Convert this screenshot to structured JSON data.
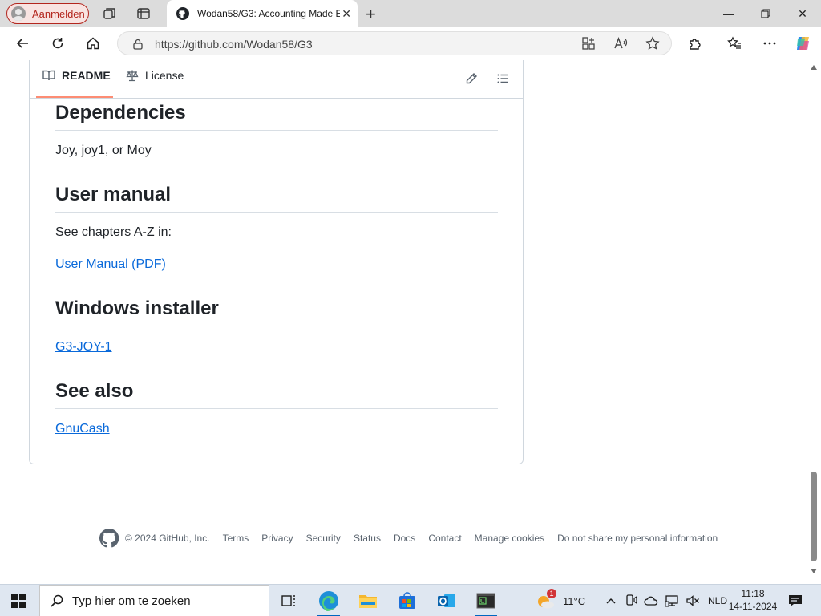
{
  "browser": {
    "profile_label": "Aanmelden",
    "tab_title": "Wodan58/G3: Accounting Made E",
    "url": "https://github.com/Wodan58/G3",
    "window_controls": [
      "minimize",
      "restore",
      "close"
    ]
  },
  "readme": {
    "tabs": [
      {
        "label": "README",
        "icon": "book-icon",
        "active": true
      },
      {
        "label": "License",
        "icon": "scale-icon",
        "active": false
      }
    ],
    "sections": [
      {
        "heading": "Dependencies",
        "text": "Joy, joy1, or Moy"
      },
      {
        "heading": "User manual",
        "text": "See chapters A-Z in:",
        "link": "User Manual (PDF)"
      },
      {
        "heading": "Windows installer",
        "link": "G3-JOY-1"
      },
      {
        "heading": "See also",
        "link": "GnuCash"
      }
    ]
  },
  "footer": {
    "copyright": "© 2024 GitHub, Inc.",
    "links": [
      "Terms",
      "Privacy",
      "Security",
      "Status",
      "Docs",
      "Contact",
      "Manage cookies",
      "Do not share my personal information"
    ]
  },
  "taskbar": {
    "search_placeholder": "Typ hier om te zoeken",
    "weather_temp": "11°C",
    "weather_badge": "1",
    "language": "NLD",
    "time": "11:18",
    "date": "14-11-2024"
  },
  "colors": {
    "link": "#0969da",
    "tab_underline": "#fd8c73",
    "profile_accent": "#b3261e",
    "taskbar": "#dfe7f1"
  }
}
